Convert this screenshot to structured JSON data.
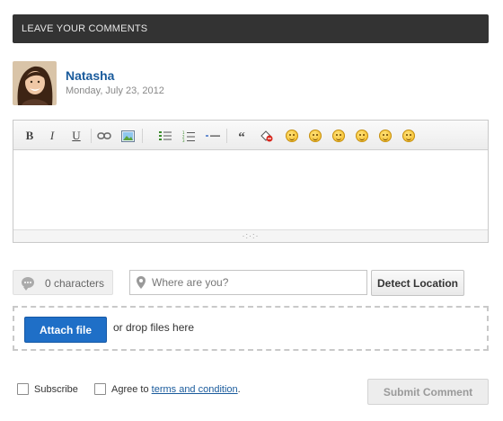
{
  "header": {
    "title": "LEAVE YOUR COMMENTS"
  },
  "user": {
    "name": "Natasha",
    "date": "Monday, July 23, 2012"
  },
  "toolbar": {
    "bold_label": "B",
    "italic_label": "I",
    "underline_label": "U",
    "quote_label": "“",
    "icons": [
      "bold-icon",
      "italic-icon",
      "underline-icon",
      "link-icon",
      "image-icon",
      "bullet-list-icon",
      "numbered-list-icon",
      "horizontal-rule-icon",
      "quote-icon",
      "eraser-icon",
      "smiley-smile-icon",
      "smiley-grin-icon",
      "smiley-surprised-icon",
      "smiley-tongue-icon",
      "smiley-sad-icon",
      "smiley-wink-icon"
    ]
  },
  "editor": {
    "value": "",
    "resize_handle": "·:·:·"
  },
  "char_count": {
    "text": "0 characters"
  },
  "location": {
    "placeholder": "Where are you?",
    "value": "",
    "detect_label": "Detect Location"
  },
  "attach": {
    "button_label": "Attach file",
    "drop_text": "or drop files here"
  },
  "subscribe": {
    "label": "Subscribe",
    "checked": false
  },
  "terms": {
    "prefix": "Agree to ",
    "link_text": "terms and condition",
    "suffix": ".",
    "checked": false
  },
  "submit": {
    "label": "Submit Comment",
    "enabled": false
  },
  "colors": {
    "header_bg": "#333333",
    "name": "#1a5b9c",
    "attach_button": "#1f6fc7",
    "link": "#1a5b9c"
  }
}
